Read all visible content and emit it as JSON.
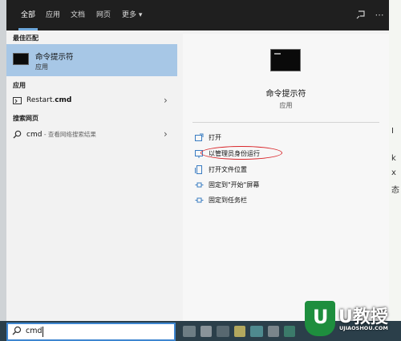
{
  "tabs": [
    "全部",
    "应用",
    "文档",
    "网页",
    "更多 ▾"
  ],
  "topbar_icons": [
    "feedback-icon",
    "more-icon"
  ],
  "left": {
    "best_match_header": "最佳匹配",
    "best_match": {
      "name": "命令提示符",
      "type": "应用"
    },
    "apps_header": "应用",
    "apps": [
      {
        "prefix": "Restart.",
        "bold": "cmd"
      }
    ],
    "web_header": "搜索网页",
    "web": {
      "query": "cmd",
      "hint": " - 查看网络搜索结果"
    }
  },
  "right": {
    "title": "命令提示符",
    "subtitle": "应用",
    "actions": [
      "打开",
      "以管理员身份运行",
      "打开文件位置",
      "固定到\"开始\"屏幕",
      "固定到任务栏"
    ]
  },
  "search": {
    "value": "cmd"
  },
  "watermark": {
    "brand": "U教授",
    "url": "UJIAOSHOU.COM"
  },
  "colors": {
    "selection": "#a7c7e6",
    "accent": "#3e86d0",
    "annotation": "#d9262a"
  }
}
